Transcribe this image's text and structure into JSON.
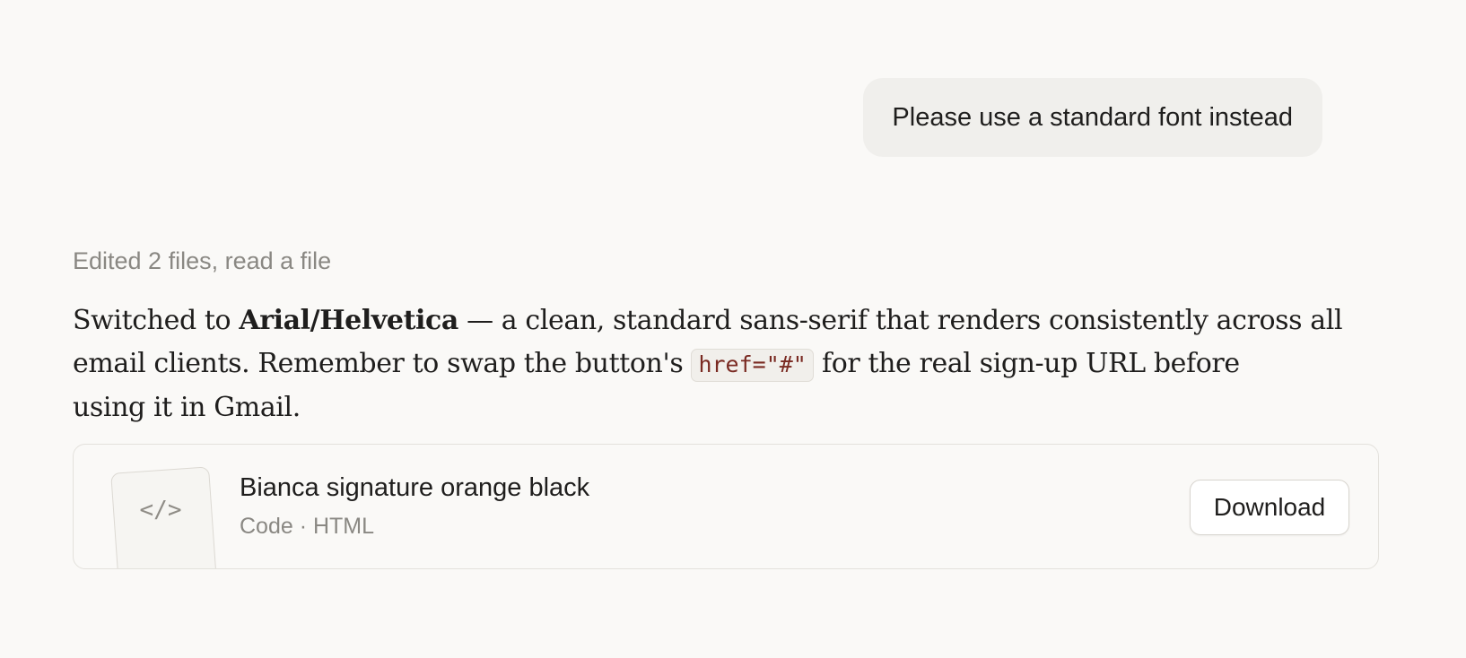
{
  "user_message": {
    "text": "Please use a standard font instead"
  },
  "assistant": {
    "activity_summary": "Edited 2 files, read a file",
    "reply": {
      "line1_prefix": "Switched to ",
      "line1_bold": "Arial/Helvetica",
      "line1_suffix": " — a clean, standard sans-serif that renders consistently across all",
      "line2_prefix": "email clients. Remember to swap the button's ",
      "line2_code": "href=\"#\"",
      "line2_suffix": " for the real sign-up URL before",
      "line3": "using it in Gmail."
    },
    "file_card": {
      "icon": "code-icon",
      "icon_glyph": "</>",
      "name": "Bianca signature orange black",
      "meta": "Code · HTML",
      "download_label": "Download"
    }
  },
  "colors": {
    "background": "#faf9f7",
    "user_bubble": "#f0efec",
    "muted_text": "#8a8883",
    "code_text": "#7a2a22"
  }
}
